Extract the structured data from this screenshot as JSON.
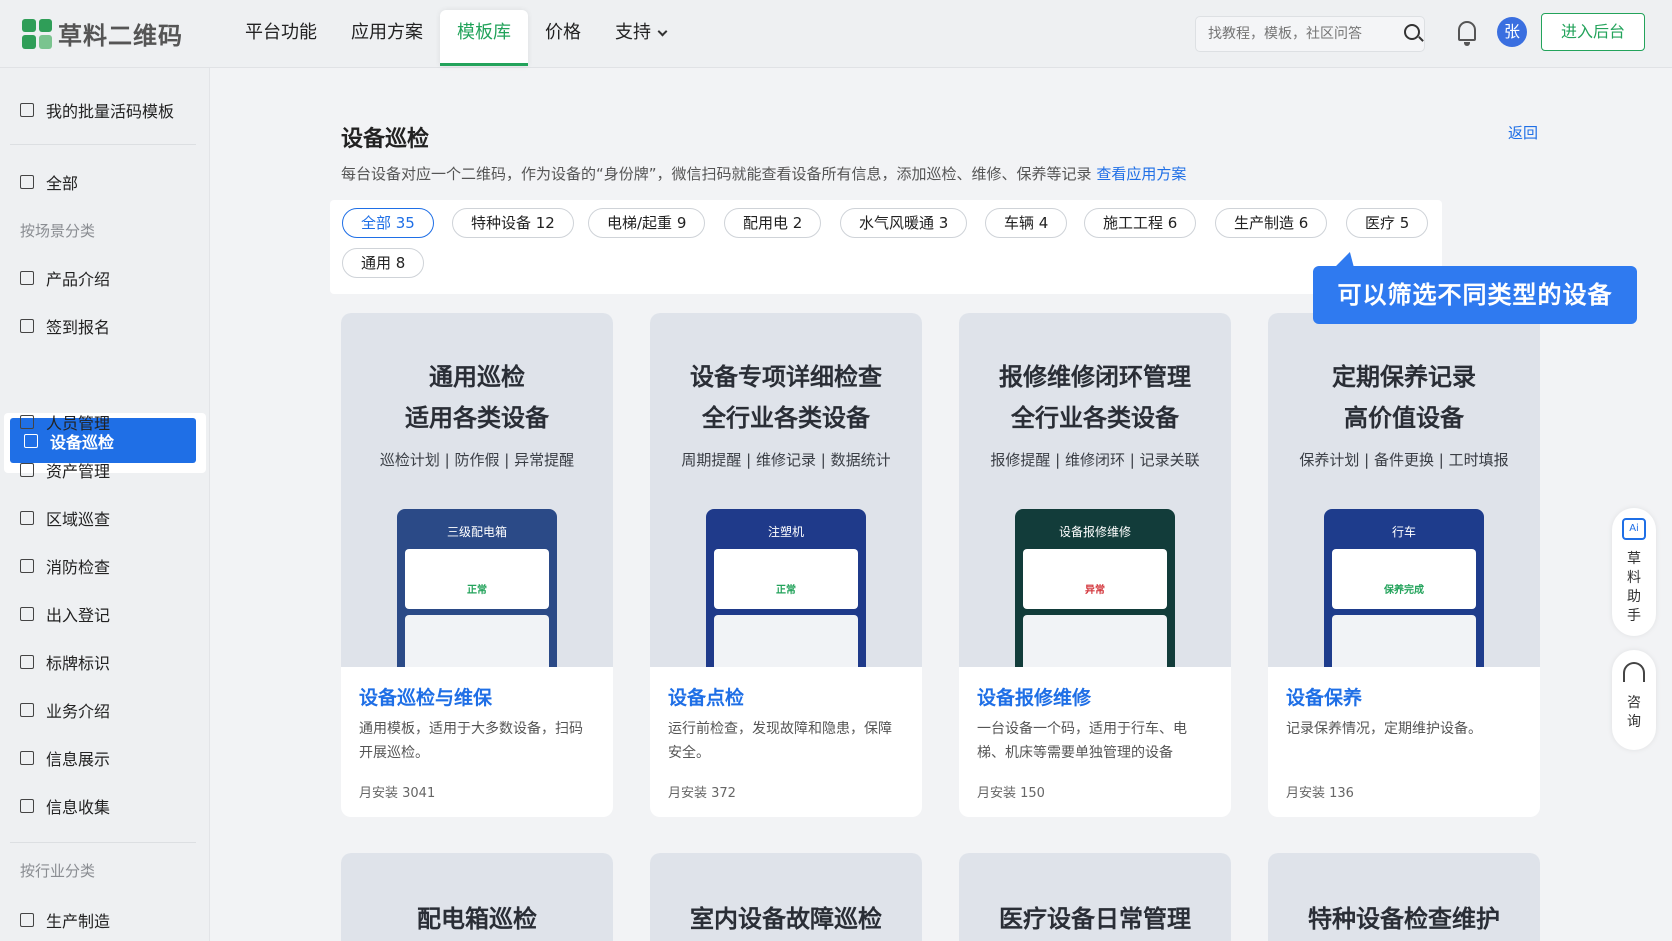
{
  "header": {
    "logo_text": "草料二维码",
    "nav": [
      "平台功能",
      "应用方案",
      "模板库",
      "价格",
      "支持"
    ],
    "search_placeholder": "找教程，模板，社区问答",
    "avatar_initial": "张",
    "enter_label": "进入后台"
  },
  "sidebar": {
    "my_templates": "我的批量活码模板",
    "all": "全部",
    "group_scene": "按场景分类",
    "scene_items": [
      "产品介绍",
      "签到报名",
      "设备巡检",
      "人员管理",
      "资产管理",
      "区域巡查",
      "消防检查",
      "出入登记",
      "标牌标识",
      "业务介绍",
      "信息展示",
      "信息收集"
    ],
    "active_item": "设备巡检",
    "group_industry": "按行业分类",
    "industry_items": [
      "生产制造"
    ]
  },
  "main": {
    "title": "设备巡检",
    "desc": "每台设备对应一个二维码，作为设备的“身份牌”，微信扫码就能查看设备所有信息，添加巡检、维修、保养等记录",
    "desc_link": "查看应用方案",
    "back": "返回",
    "filters": [
      "全部 35",
      "特种设备 12",
      "电梯/起重 9",
      "配用电 2",
      "水气风暖通 3",
      "车辆 4",
      "施工工程 6",
      "生产制造 6",
      "医疗 5",
      "通用 8"
    ],
    "tooltip": "可以筛选不同类型的设备",
    "cards": [
      {
        "h1a": "通用巡检",
        "h1b": "适用各类设备",
        "sub": "巡检计划 | 防作假 | 异常提醒",
        "phone_title": "三级配电箱",
        "phone_status": "正常",
        "name": "设备巡检与维保",
        "desc": "通用模板，适用于大多数设备，扫码开展巡检。",
        "stat": "月安装  3041"
      },
      {
        "h1a": "设备专项详细检查",
        "h1b": "全行业各类设备",
        "sub": "周期提醒 | 维修记录 | 数据统计",
        "phone_title": "注塑机",
        "phone_status": "正常",
        "name": "设备点检",
        "desc": "运行前检查，发现故障和隐患，保障安全。",
        "stat": "月安装  372"
      },
      {
        "h1a": "报修维修闭环管理",
        "h1b": "全行业各类设备",
        "sub": "报修提醒 | 维修闭环 | 记录关联",
        "phone_title": "设备报修维修",
        "phone_status": "异常",
        "name": "设备报修维修",
        "desc": "一台设备一个码，适用于行车、电梯、机床等需要单独管理的设备",
        "stat": "月安装  150"
      },
      {
        "h1a": "定期保养记录",
        "h1b": "高价值设备",
        "sub": "保养计划 | 备件更换 | 工时填报",
        "phone_title": "行车",
        "phone_status": "保养完成",
        "name": "设备保养",
        "desc": "记录保养情况，定期维护设备。",
        "stat": "月安装  136"
      }
    ],
    "cards_row2": [
      "配电箱巡检",
      "室内设备故障巡检",
      "医疗设备日常管理",
      "特种设备检查维护"
    ]
  },
  "float": {
    "ai_label": "Ai",
    "ai_text": "草料助手",
    "consult_text": "咨询"
  },
  "colors": {
    "brand_green": "#23a35b",
    "accent_blue": "#1f6fe6"
  }
}
